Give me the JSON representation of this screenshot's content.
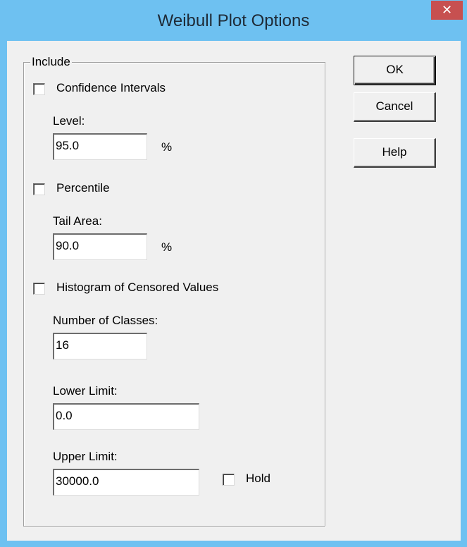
{
  "window": {
    "title": "Weibull Plot Options",
    "close_glyph": "✕",
    "titlebar_color": "#6ec1f1",
    "close_color": "#c75050"
  },
  "group": {
    "label": "Include"
  },
  "options": {
    "confidence_intervals": {
      "label": "Confidence Intervals",
      "checked": false
    },
    "level": {
      "label": "Level:",
      "value": "95.0",
      "unit": "%"
    },
    "percentile": {
      "label": "Percentile",
      "checked": false
    },
    "tail_area": {
      "label": "Tail Area:",
      "value": "90.0",
      "unit": "%"
    },
    "histogram": {
      "label": "Histogram of Censored Values",
      "checked": false
    },
    "number_of_classes": {
      "label": "Number of Classes:",
      "value": "16"
    },
    "lower_limit": {
      "label": "Lower Limit:",
      "value": "0.0"
    },
    "upper_limit": {
      "label": "Upper Limit:",
      "value": "30000.0"
    },
    "hold": {
      "label": "Hold",
      "checked": false
    }
  },
  "buttons": {
    "ok": "OK",
    "cancel": "Cancel",
    "help": "Help"
  }
}
